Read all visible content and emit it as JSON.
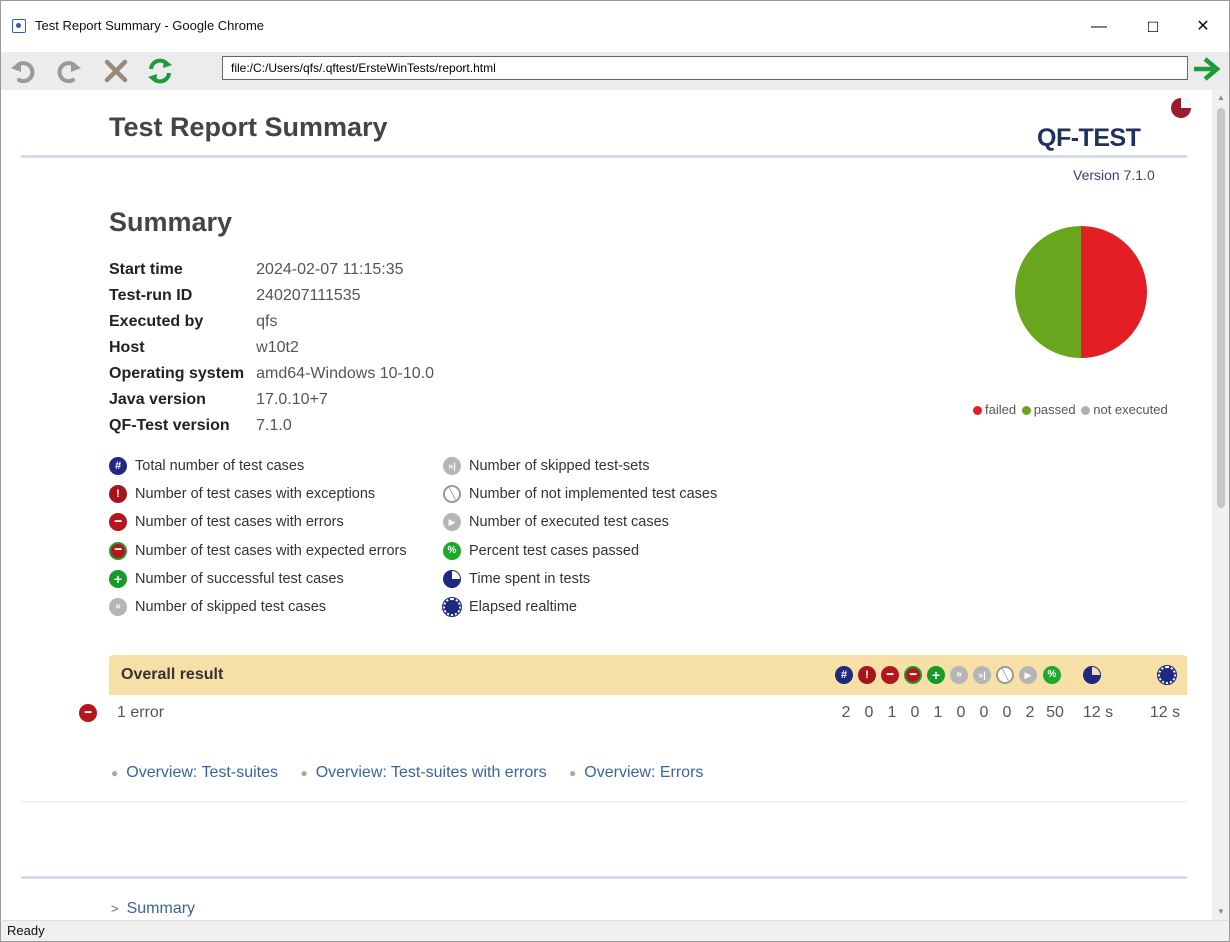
{
  "window": {
    "title": "Test Report Summary - Google Chrome",
    "minimize": "—",
    "maximize": "☐",
    "close": "✕"
  },
  "toolbar": {
    "url": "file:/C:/Users/qfs/.qftest/ErsteWinTests/report.html"
  },
  "report": {
    "title": "Test Report Summary",
    "logo_text": "QF-TEST",
    "version": "Version 7.1.0",
    "summary_heading": "Summary",
    "info": [
      {
        "key": "Start time",
        "value": "2024-02-07 11:15:35"
      },
      {
        "key": "Test-run ID",
        "value": "240207111535"
      },
      {
        "key": "Executed by",
        "value": "qfs"
      },
      {
        "key": "Host",
        "value": "w10t2"
      },
      {
        "key": "Operating system",
        "value": "amd64-Windows 10-10.0"
      },
      {
        "key": "Java version",
        "value": "17.0.10+7"
      },
      {
        "key": "QF-Test version",
        "value": "7.1.0"
      }
    ],
    "pie": {
      "failed": 1,
      "passed": 1,
      "not_executed": 0,
      "colors": {
        "failed": "#e31e24",
        "passed": "#6aa61d",
        "not_executed": "#b0b0b0"
      }
    },
    "legend": {
      "failed": "failed",
      "passed": "passed",
      "not_executed": "not executed"
    },
    "key_left": [
      {
        "icon": "total-icon",
        "label": "Total number of test cases"
      },
      {
        "icon": "exception-icon",
        "label": "Number of test cases with exceptions"
      },
      {
        "icon": "error-icon",
        "label": "Number of test cases with errors"
      },
      {
        "icon": "expected-error-icon",
        "label": "Number of test cases with expected errors"
      },
      {
        "icon": "success-icon",
        "label": "Number of successful test cases"
      },
      {
        "icon": "skipped-icon",
        "label": "Number of skipped test cases"
      }
    ],
    "key_right": [
      {
        "icon": "skipped-sets-icon",
        "label": "Number of skipped test-sets"
      },
      {
        "icon": "not-implemented-icon",
        "label": "Number of not implemented test cases"
      },
      {
        "icon": "executed-icon",
        "label": "Number of executed test cases"
      },
      {
        "icon": "percent-icon",
        "label": "Percent test cases passed"
      },
      {
        "icon": "time-icon",
        "label": "Time spent in tests"
      },
      {
        "icon": "elapsed-icon",
        "label": "Elapsed realtime"
      }
    ],
    "overall": {
      "label": "Overall result",
      "result_text": "1 error",
      "values": [
        "2",
        "0",
        "1",
        "0",
        "1",
        "0",
        "0",
        "0",
        "2",
        "50",
        "12 s",
        "12 s"
      ]
    },
    "links": [
      "Overview: Test-suites",
      "Overview: Test-suites with errors",
      "Overview: Errors"
    ],
    "bottom_link": "Summary"
  },
  "status": "Ready"
}
